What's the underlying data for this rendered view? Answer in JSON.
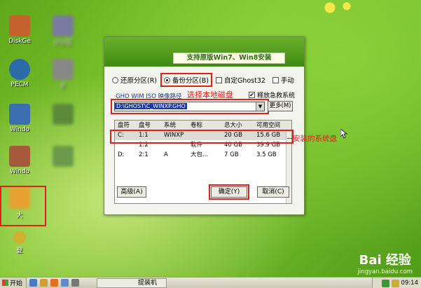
{
  "desktop": {
    "icons": [
      {
        "label": "DiskGe",
        "color": "#c4622e"
      },
      {
        "label": "识分区",
        "color": "#7a7aa0"
      },
      {
        "label": "PECM",
        "color": "#2d6aa8"
      },
      {
        "label": "手",
        "color": "#888888"
      },
      {
        "label": "Windo",
        "color": "#3b6eb0"
      },
      {
        "label": "Windo",
        "color": "#a55a3a"
      },
      {
        "label": "大",
        "color": "#e8a030"
      },
      {
        "label": "登",
        "color": "#d0b030"
      }
    ]
  },
  "dialog": {
    "title": "支持原版Win7、Win8安装",
    "radios": [
      {
        "label": "还原分区(R)",
        "selected": false
      },
      {
        "label": "备份分区(B)",
        "selected": true
      }
    ],
    "checks": [
      {
        "label": "自定Ghost32",
        "checked": false
      },
      {
        "label": "手动",
        "checked": false
      }
    ],
    "path_label": "GHO WIM ISO 映像路径",
    "local_disk_hint": "选择本地磁盘",
    "release_label": "释放急救系统",
    "path_value": "D:\\GHOST\\C_WINXP.GHO",
    "more_label": "更多(M)",
    "table": {
      "headers": [
        "盘符",
        "盘号",
        "系统",
        "卷标",
        "总大小",
        "可用空间"
      ],
      "rows": [
        [
          "C:",
          "1:1",
          "WINXP",
          "",
          "20 GB",
          "15.6 GB"
        ],
        [
          "",
          "1:2",
          "",
          "软件",
          "40 GB",
          "39.9 GB"
        ],
        [
          "D:",
          "2:1",
          "A",
          "大包...",
          "7 GB",
          "3.5 GB"
        ]
      ]
    },
    "buttons": {
      "advanced": "高级(A)",
      "ok": "确定(Y)",
      "cancel": "取消(C)"
    }
  },
  "annotation": {
    "system_disk": "安装的系统盘"
  },
  "taskbar": {
    "start_label": "开始",
    "task_label": "提装机",
    "clock": "09:14"
  },
  "watermark": {
    "logo": "Bai 经验",
    "url": "jingyan.baidu.com"
  }
}
